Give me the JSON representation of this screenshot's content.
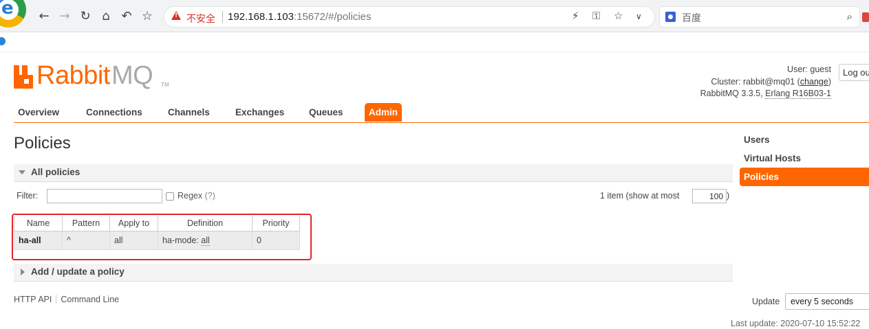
{
  "browser": {
    "security_label": "不安全",
    "url_host": "192.168.1.103",
    "url_rest": ":15672/#/policies",
    "search_placeholder": "百度"
  },
  "brand": {
    "rabbit": "Rabbit",
    "mq": "MQ",
    "tm": "TM",
    "accent_color": "#ff6600"
  },
  "login": {
    "user_label": "User:",
    "user": "guest",
    "cluster_label": "Cluster:",
    "cluster": "rabbit@mq01",
    "change_label": "change",
    "version_prefix": "RabbitMQ 3.3.5,",
    "erlang": "Erlang R16B03-1",
    "logout_label": "Log out"
  },
  "tabs": [
    {
      "label": "Overview"
    },
    {
      "label": "Connections"
    },
    {
      "label": "Channels"
    },
    {
      "label": "Exchanges"
    },
    {
      "label": "Queues"
    },
    {
      "label": "Admin"
    }
  ],
  "page_title": "Policies",
  "all_policies": {
    "label": "All policies",
    "filter_label": "Filter:",
    "regex_label": "Regex",
    "regex_help": "(?)",
    "paging_text": "1 item (show at most",
    "paging_value": "100",
    "paging_close": ")",
    "columns": [
      "Name",
      "Pattern",
      "Apply to",
      "Definition",
      "Priority"
    ],
    "rows": [
      {
        "name": "ha-all",
        "pattern": "^",
        "apply_to": "all",
        "def_key": "ha-mode:",
        "def_val": "all",
        "priority": "0"
      }
    ]
  },
  "add_policy": {
    "label": "Add / update a policy"
  },
  "footer": {
    "http_api": "HTTP API",
    "command_line": "Command Line"
  },
  "sidebar": [
    {
      "label": "Users"
    },
    {
      "label": "Virtual Hosts"
    },
    {
      "label": "Policies"
    }
  ],
  "update": {
    "label": "Update",
    "value": "every 5 seconds",
    "last_update": "Last update: 2020-07-10 15:52:22"
  }
}
